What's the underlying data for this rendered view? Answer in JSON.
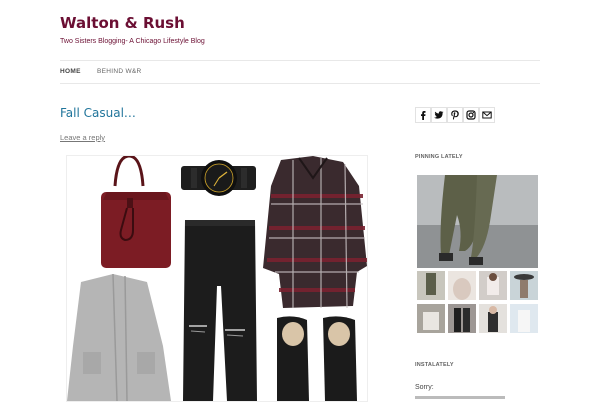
{
  "site": {
    "title": "Walton & Rush",
    "tagline": "Two Sisters Blogging- A Chicago Lifestyle Blog"
  },
  "nav": {
    "items": [
      {
        "label": "HOME",
        "active": true
      },
      {
        "label": "BEHIND W&R",
        "active": false
      }
    ]
  },
  "post": {
    "title": "Fall Casual…",
    "leave_reply": "Leave a reply"
  },
  "share": {
    "icons": [
      "facebook-icon",
      "twitter-icon",
      "pinterest-icon",
      "instagram-icon",
      "email-icon"
    ]
  },
  "sidebar": {
    "pinning_title": "PINNING LATELY",
    "instalately_title": "INSTALATELY",
    "sorry": "Sorry:"
  },
  "colors": {
    "brand": "#6b0f33",
    "link": "#21759b",
    "bag": "#7c1c24",
    "flannel_dark": "#3a2a2e",
    "flannel_red": "#7a2230",
    "cardigan": "#b5b5b5",
    "jeans": "#1c1c1c",
    "pants_olive": "#5d6048"
  }
}
